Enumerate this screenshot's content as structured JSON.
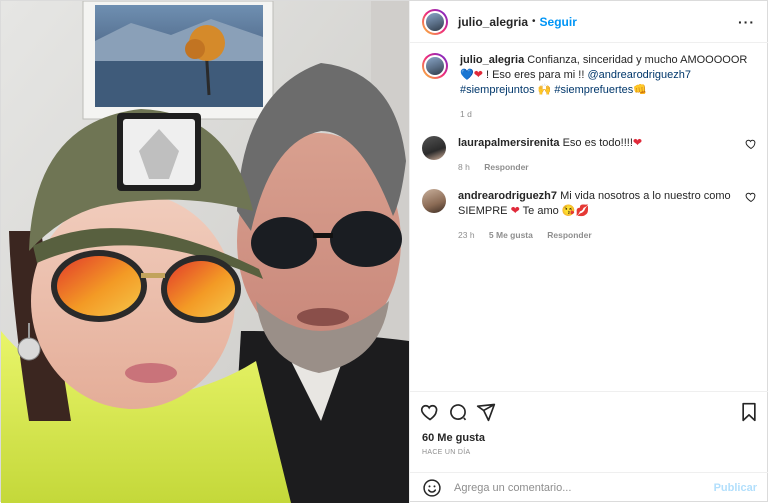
{
  "header": {
    "username": "julio_alegria",
    "dot": "•",
    "follow_label": "Seguir",
    "more_icon": "more-icon"
  },
  "caption": {
    "username": "julio_alegria",
    "text_1": "Confianza, sinceridad y mucho AMOOOOOR",
    "emoji_1": "💙",
    "emoji_2": "❤",
    "text_2": "! Eso eres para mi !!",
    "mention": "@andrearodriguezh7",
    "tag_1": "#siemprejuntos",
    "emoji_3": "🙌",
    "tag_2": "#siemprefuertes",
    "emoji_4": "👊",
    "age": "1 d"
  },
  "comments": [
    {
      "username": "laurapalmersirenita",
      "text": "Eso es todo!!!!",
      "emoji": "❤",
      "age": "8 h",
      "reply": "Responder",
      "likes": ""
    },
    {
      "username": "andrearodriguezh7",
      "text": "Mi vida nosotros a lo nuestro como SIEMPRE",
      "emoji": "❤",
      "text_b": "Te amo",
      "emoji_b": "😘💋",
      "age": "23 h",
      "likes": "5 Me gusta",
      "reply": "Responder"
    }
  ],
  "likes_label": "60 Me gusta",
  "time_label": "HACE UN DÍA",
  "add_comment": {
    "placeholder": "Agrega un comentario...",
    "publish": "Publicar"
  },
  "colors": {
    "accent": "#0095f6",
    "muted": "#8e8e8e",
    "publish_disabled": "#b2dffc"
  }
}
